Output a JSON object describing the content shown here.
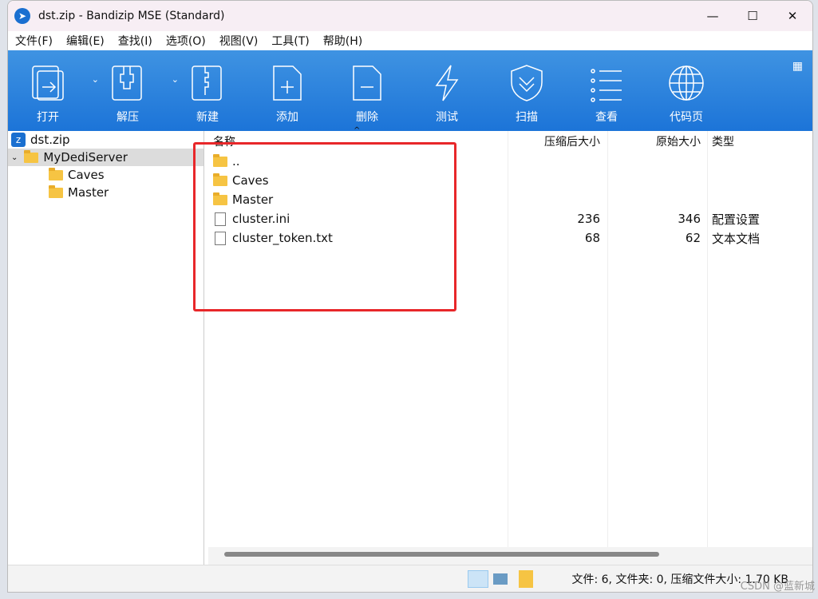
{
  "window": {
    "title": "dst.zip - Bandizip MSE (Standard)"
  },
  "menu": [
    "文件(F)",
    "编辑(E)",
    "查找(I)",
    "选项(O)",
    "视图(V)",
    "工具(T)",
    "帮助(H)"
  ],
  "toolbar": [
    {
      "label": "打开",
      "icon": "open-icon"
    },
    {
      "label": "解压",
      "icon": "extract-icon"
    },
    {
      "label": "新建",
      "icon": "new-archive-icon"
    },
    {
      "label": "添加",
      "icon": "add-file-icon"
    },
    {
      "label": "删除",
      "icon": "delete-file-icon"
    },
    {
      "label": "测试",
      "icon": "test-icon"
    },
    {
      "label": "扫描",
      "icon": "scan-icon"
    },
    {
      "label": "查看",
      "icon": "view-icon"
    },
    {
      "label": "代码页",
      "icon": "codepage-icon"
    }
  ],
  "tree": [
    {
      "label": "dst.zip"
    },
    {
      "label": "MyDediServer"
    },
    {
      "label": "Caves"
    },
    {
      "label": "Master"
    }
  ],
  "columns": {
    "name": "名称",
    "packed": "压缩后大小",
    "original": "原始大小",
    "type": "类型"
  },
  "files": [
    {
      "name": "..",
      "packed": "",
      "original": "",
      "type": "",
      "kind": "folder"
    },
    {
      "name": "Caves",
      "packed": "",
      "original": "",
      "type": "",
      "kind": "folder"
    },
    {
      "name": "Master",
      "packed": "",
      "original": "",
      "type": "",
      "kind": "folder"
    },
    {
      "name": "cluster.ini",
      "packed": "236",
      "original": "346",
      "type": "配置设置",
      "kind": "file"
    },
    {
      "name": "cluster_token.txt",
      "packed": "68",
      "original": "62",
      "type": "文本文档",
      "kind": "file"
    }
  ],
  "status": {
    "text": "文件: 6, 文件夹: 0, 压缩文件大小: 1.70 KB"
  },
  "watermark": "CSDN @蓝新城"
}
